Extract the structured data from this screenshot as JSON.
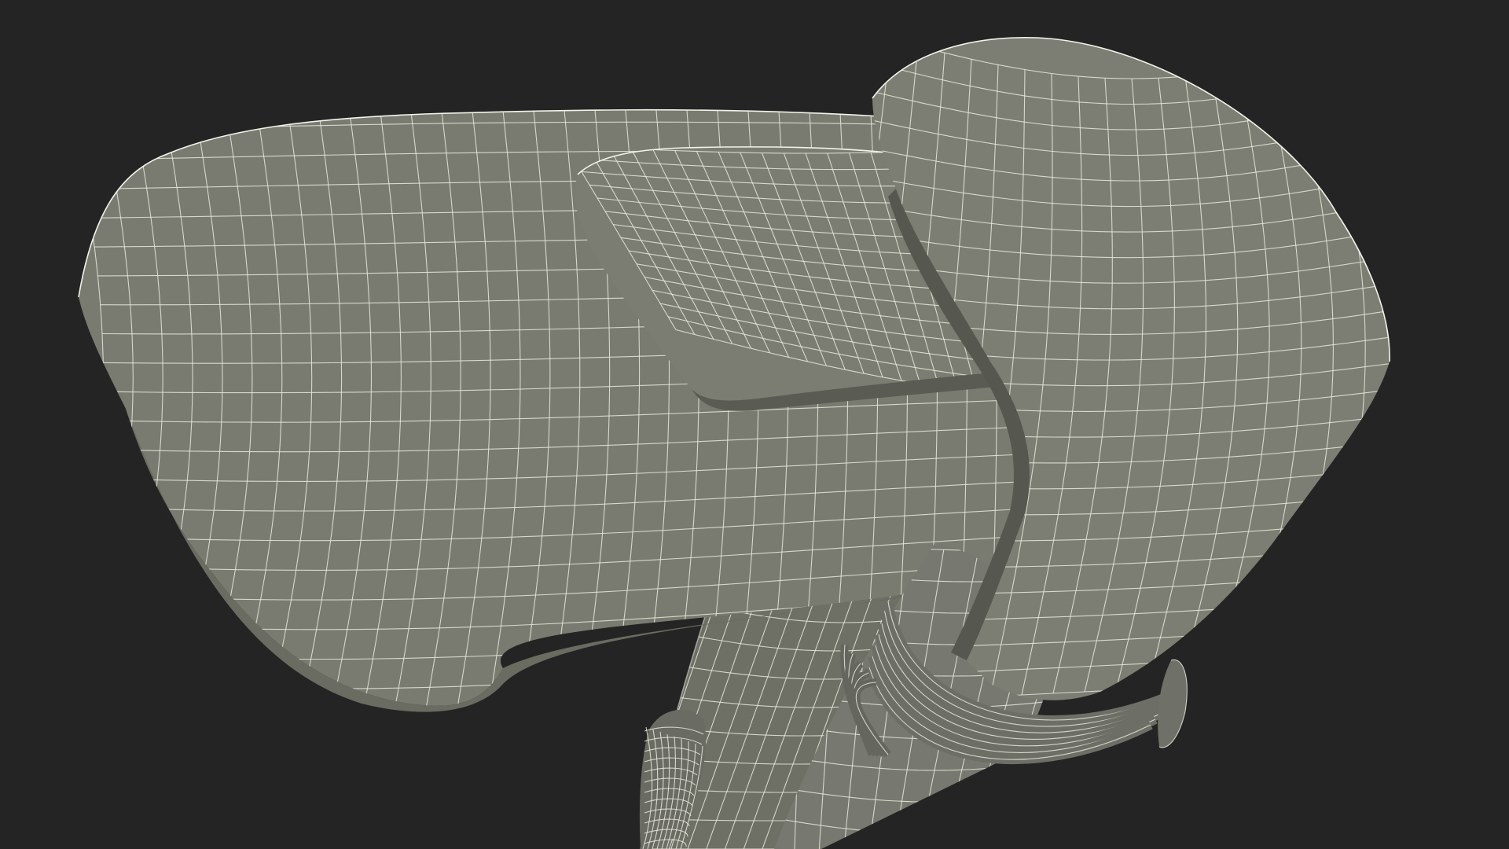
{
  "scene": {
    "subject": "wireframe-render",
    "colors": {
      "background": "#242424",
      "surface": "#7b7c70",
      "surface_dark": "#5f6057",
      "surface_shadow": "#4a4b44",
      "wire": "#e8e8dc"
    }
  }
}
